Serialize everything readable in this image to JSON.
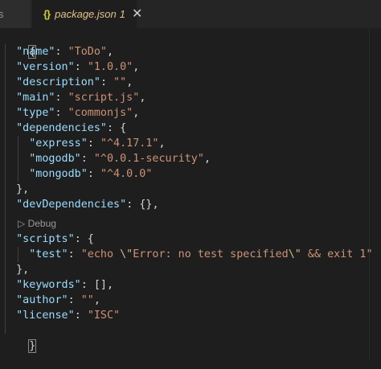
{
  "tabs": {
    "previous_label": "s",
    "active": {
      "icon": "{}",
      "label": "package.json",
      "problems": "1",
      "close": "✕"
    }
  },
  "codelens": "▷ Debug",
  "lines": {
    "l0": "{",
    "name_key": "\"name\"",
    "name_val": "\"ToDo\"",
    "version_key": "\"version\"",
    "version_val": "\"1.0.0\"",
    "description_key": "\"description\"",
    "description_val": "\"\"",
    "main_key": "\"main\"",
    "main_val": "\"script.js\"",
    "type_key": "\"type\"",
    "type_val": "\"commonjs\"",
    "dependencies_key": "\"dependencies\"",
    "express_key": "\"express\"",
    "express_val": "\"^4.17.1\"",
    "mogodb_key": "\"mogodb\"",
    "mogodb_val": "\"^0.0.1-security\"",
    "mongodb_key": "\"mongodb\"",
    "mongodb_val": "\"^4.0.0\"",
    "devdeps_key": "\"devDependencies\"",
    "devdeps_val": "{}",
    "scripts_key": "\"scripts\"",
    "test_key": "\"test\"",
    "test_val_a": "\"echo ",
    "test_esc1": "\\\"",
    "test_val_b": "Error: no test specified",
    "test_esc2": "\\\"",
    "test_val_c": " && exit 1\"",
    "keywords_key": "\"keywords\"",
    "keywords_val": "[]",
    "author_key": "\"author\"",
    "author_val": "\"\"",
    "license_key": "\"license\"",
    "license_val": "\"ISC\"",
    "close": "}"
  }
}
